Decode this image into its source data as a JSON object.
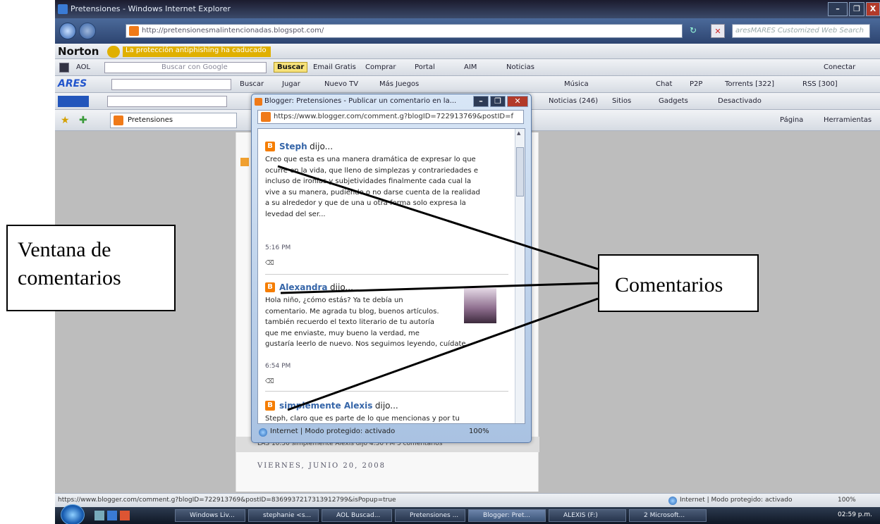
{
  "window": {
    "title": "Pretensiones - Windows Internet Explorer",
    "controls": [
      "–",
      "❐",
      "X"
    ]
  },
  "address_bar": {
    "url": "http://pretensionesmalintencionadas.blogspot.com/",
    "search_placeholder": "aresMARES Customized Web Search"
  },
  "toolbars": {
    "norton": {
      "logo": "Norton",
      "text": "La protección antiphishing ha caducado"
    },
    "aol": {
      "label": "AOL",
      "search_hint": "Buscar con Google",
      "buscar": "Buscar",
      "items": [
        "Email Gratis",
        "Comprar",
        "Portal",
        "AIM",
        "Noticias"
      ],
      "right": "Conectar"
    },
    "ares": {
      "brand": "ARES",
      "items": [
        "Buscar",
        "Jugar",
        "Nuevo TV",
        "Más Juegos",
        "Música",
        "Chat",
        "P2P",
        "Torrents [322]",
        "RSS [300]"
      ]
    },
    "row4": {
      "items": [
        "Noticias (246)",
        "Sitios",
        "Gadgets",
        "Desactivado"
      ]
    },
    "tabs": {
      "active_tab": "Pretensiones",
      "right_items": [
        "Página",
        "Herramientas"
      ]
    }
  },
  "popup": {
    "title": "Blogger: Pretensiones - Publicar un comentario en la...",
    "url": "https://www.blogger.com/comment.g?blogID=722913769&postID=f",
    "comments": [
      {
        "author": "Steph",
        "verb": "dijo...",
        "lines": [
          "Creo que esta es una manera dramática de expresar lo que",
          "ocurre en la vida, que lleno de simplezas y contrariedades e",
          "incluso de ironías y subjetividades finalmente cada cual la",
          "vive a su manera, pudiendo o no darse cuenta de la realidad",
          "a su alrededor y que de una u otra forma solo expresa la",
          "levedad del ser..."
        ],
        "time": "5:16 PM"
      },
      {
        "author": "Alexandra",
        "verb": "dijo...",
        "lines": [
          "Hola niño, ¿cómo estás? Ya te debía un",
          "comentario. Me agrada tu blog, buenos artículos.",
          "también recuerdo el texto literario de tu autoría",
          "que me enviaste, muy bueno la verdad, me",
          "gustaría leerlo de nuevo. Nos seguimos leyendo, cuídate."
        ],
        "time": "6:54 PM"
      },
      {
        "author": "simplemente Alexis",
        "verb": "dijo...",
        "lines": [
          "Steph, claro que es parte de lo que mencionas y por tu"
        ]
      }
    ],
    "status": "Internet | Modo protegido: activado",
    "zoom": "100%"
  },
  "page": {
    "post_footer": "LAS 10:50  simplemente Alexis dijo 4:50 PM  5 comentarios",
    "date_header": "VIERNES, JUNIO 20, 2008"
  },
  "status_bar": {
    "url": "https://www.blogger.com/comment.g?blogID=722913769&postID=8369937217313912799&isPopup=true",
    "zone": "Internet | Modo protegido: activado",
    "zoom": "100%"
  },
  "taskbar": {
    "tasks": [
      "Windows Liv...",
      "stephanie <s...",
      "AOL Buscad...",
      "Pretensiones ...",
      "Blogger: Pret...",
      "ALEXIS (F:)",
      "2 Microsoft..."
    ],
    "clock": "02:59 p.m."
  },
  "annotations": {
    "left_box": [
      "Ventana de",
      "comentarios"
    ],
    "right_box": "Comentarios"
  }
}
